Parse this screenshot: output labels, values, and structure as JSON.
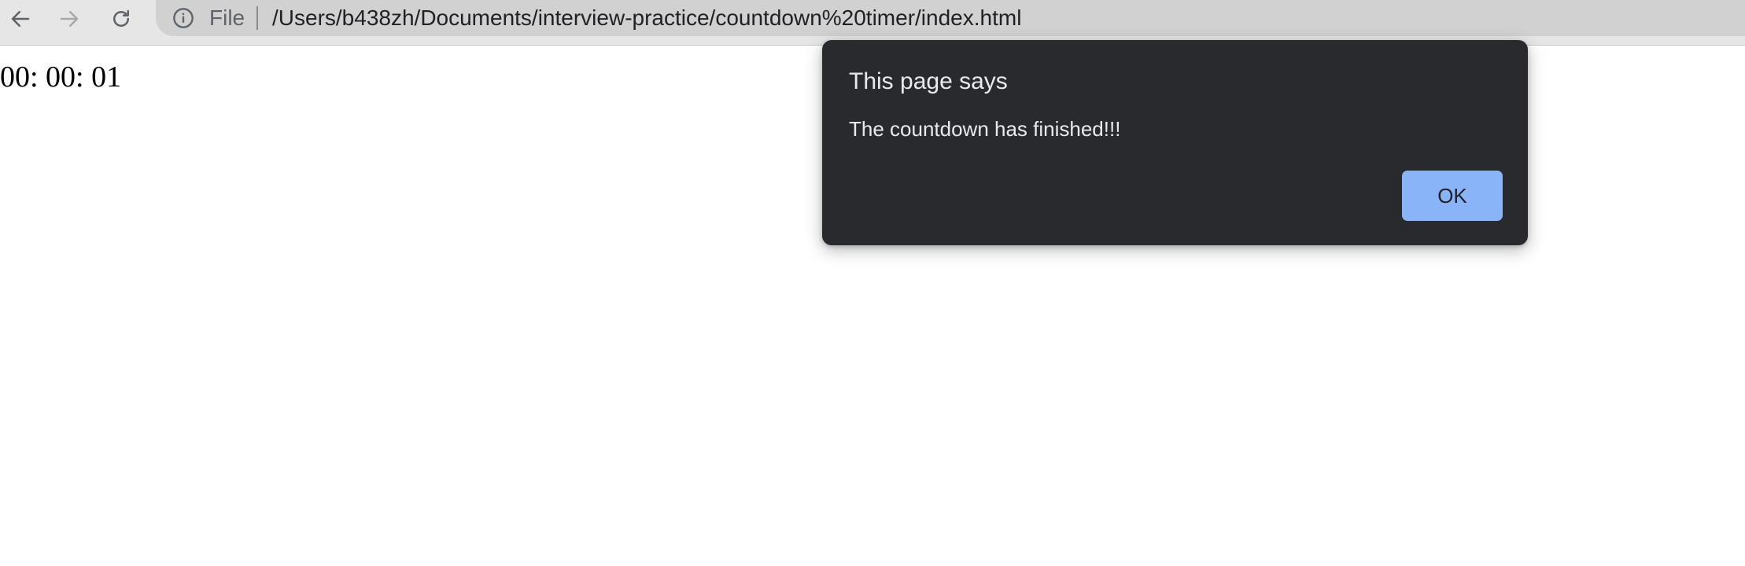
{
  "browser": {
    "toolbar": {
      "back_icon": "arrow-left-icon",
      "forward_icon": "arrow-right-icon",
      "reload_icon": "reload-icon"
    },
    "omnibox": {
      "info_icon": "info-icon",
      "scheme_label": "File",
      "url": "/Users/b438zh/Documents/interview-practice/countdown%20timer/index.html"
    }
  },
  "page": {
    "timer_display": "00: 00: 01"
  },
  "dialog": {
    "title": "This page says",
    "message": "The countdown has finished!!!",
    "ok_label": "OK",
    "accent_color": "#8ab4f8",
    "background_color": "#292a2d"
  }
}
